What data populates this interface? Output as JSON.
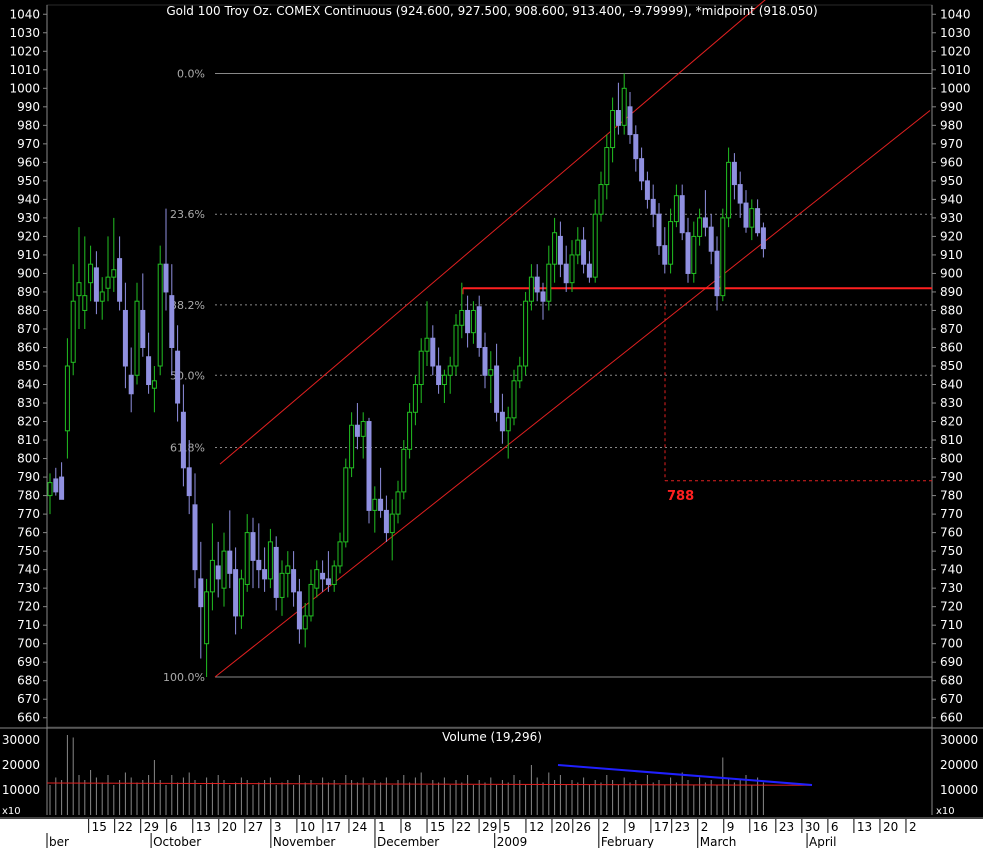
{
  "chart_data": [
    {
      "type": "candlestick",
      "title": "Gold 100 Troy Oz. COMEX Continuous (924.600, 927.500, 908.600, 913.400, -9.79999), *midpoint (918.050)",
      "ylim": [
        655,
        1045
      ],
      "y_ticks": [
        "660",
        "670",
        "680",
        "690",
        "700",
        "710",
        "720",
        "730",
        "740",
        "750",
        "760",
        "770",
        "780",
        "790",
        "800",
        "810",
        "820",
        "830",
        "840",
        "850",
        "860",
        "870",
        "880",
        "890",
        "900",
        "910",
        "920",
        "930",
        "940",
        "950",
        "960",
        "970",
        "980",
        "990",
        "1000",
        "1010",
        "1020",
        "1030",
        "1040"
      ],
      "x_ticks": [
        {
          "label": "15",
          "x": 8
        },
        {
          "label": "22",
          "x": 13
        },
        {
          "label": "29",
          "x": 18
        },
        {
          "label": "6",
          "x": 23
        },
        {
          "label": "13",
          "x": 28
        },
        {
          "label": "20",
          "x": 33
        },
        {
          "label": "27",
          "x": 38
        },
        {
          "label": "3",
          "x": 43
        },
        {
          "label": "10",
          "x": 48
        },
        {
          "label": "17",
          "x": 53
        },
        {
          "label": "24",
          "x": 58
        },
        {
          "label": "1",
          "x": 63
        },
        {
          "label": "8",
          "x": 68
        },
        {
          "label": "15",
          "x": 73
        },
        {
          "label": "22",
          "x": 78
        },
        {
          "label": "29",
          "x": 83
        },
        {
          "label": "5",
          "x": 87
        },
        {
          "label": "12",
          "x": 92
        },
        {
          "label": "20",
          "x": 97
        },
        {
          "label": "26",
          "x": 101
        },
        {
          "label": "2",
          "x": 106
        },
        {
          "label": "9",
          "x": 111
        },
        {
          "label": "17",
          "x": 116
        },
        {
          "label": "23",
          "x": 120
        },
        {
          "label": "2",
          "x": 125
        },
        {
          "label": "9",
          "x": 130
        },
        {
          "label": "16",
          "x": 135
        },
        {
          "label": "23",
          "x": 140
        },
        {
          "label": "30",
          "x": 145
        },
        {
          "label": "6",
          "x": 150
        },
        {
          "label": "13",
          "x": 155
        },
        {
          "label": "20",
          "x": 160
        },
        {
          "label": "2",
          "x": 165
        }
      ],
      "month_labels": [
        {
          "label": "ber",
          "x": 0
        },
        {
          "label": "October",
          "x": 20
        },
        {
          "label": "November",
          "x": 43
        },
        {
          "label": "December",
          "x": 63
        },
        {
          "label": "2009",
          "x": 86
        },
        {
          "label": "February",
          "x": 106
        },
        {
          "label": "March",
          "x": 125
        },
        {
          "label": "April",
          "x": 146
        }
      ],
      "fib_levels": [
        {
          "label": "0.0%",
          "value": 1008
        },
        {
          "label": "23.6%",
          "value": 932
        },
        {
          "label": "38.2%",
          "value": 883
        },
        {
          "label": "50.0%",
          "value": 845
        },
        {
          "label": "61.8%",
          "value": 806
        },
        {
          "label": "100.0%",
          "value": 682
        }
      ],
      "annotation": {
        "label": "788",
        "value": 788
      },
      "support_level": 892,
      "candles": [
        {
          "o": 780,
          "h": 792,
          "l": 770,
          "c": 787
        },
        {
          "o": 789,
          "h": 795,
          "l": 780,
          "c": 782
        },
        {
          "o": 790,
          "h": 798,
          "l": 785,
          "c": 778
        },
        {
          "o": 815,
          "h": 865,
          "l": 800,
          "c": 850
        },
        {
          "o": 852,
          "h": 905,
          "l": 845,
          "c": 885
        },
        {
          "o": 888,
          "h": 925,
          "l": 870,
          "c": 895
        },
        {
          "o": 880,
          "h": 920,
          "l": 870,
          "c": 888
        },
        {
          "o": 895,
          "h": 915,
          "l": 885,
          "c": 905
        },
        {
          "o": 903,
          "h": 912,
          "l": 878,
          "c": 885
        },
        {
          "o": 885,
          "h": 898,
          "l": 875,
          "c": 890
        },
        {
          "o": 892,
          "h": 920,
          "l": 885,
          "c": 898
        },
        {
          "o": 898,
          "h": 930,
          "l": 890,
          "c": 902
        },
        {
          "o": 908,
          "h": 920,
          "l": 880,
          "c": 885
        },
        {
          "o": 880,
          "h": 895,
          "l": 838,
          "c": 850
        },
        {
          "o": 845,
          "h": 860,
          "l": 825,
          "c": 835
        },
        {
          "o": 845,
          "h": 895,
          "l": 840,
          "c": 885
        },
        {
          "o": 880,
          "h": 900,
          "l": 855,
          "c": 860
        },
        {
          "o": 855,
          "h": 868,
          "l": 835,
          "c": 840
        },
        {
          "o": 838,
          "h": 850,
          "l": 825,
          "c": 842
        },
        {
          "o": 850,
          "h": 915,
          "l": 845,
          "c": 905
        },
        {
          "o": 905,
          "h": 935,
          "l": 880,
          "c": 890
        },
        {
          "o": 888,
          "h": 905,
          "l": 845,
          "c": 860
        },
        {
          "o": 858,
          "h": 872,
          "l": 820,
          "c": 830
        },
        {
          "o": 825,
          "h": 840,
          "l": 785,
          "c": 795
        },
        {
          "o": 795,
          "h": 810,
          "l": 770,
          "c": 780
        },
        {
          "o": 775,
          "h": 792,
          "l": 730,
          "c": 740
        },
        {
          "o": 735,
          "h": 755,
          "l": 692,
          "c": 720
        },
        {
          "o": 700,
          "h": 735,
          "l": 682,
          "c": 728
        },
        {
          "o": 728,
          "h": 765,
          "l": 718,
          "c": 745
        },
        {
          "o": 742,
          "h": 755,
          "l": 725,
          "c": 735
        },
        {
          "o": 730,
          "h": 760,
          "l": 720,
          "c": 750
        },
        {
          "o": 750,
          "h": 772,
          "l": 730,
          "c": 738
        },
        {
          "o": 740,
          "h": 752,
          "l": 705,
          "c": 715
        },
        {
          "o": 715,
          "h": 740,
          "l": 708,
          "c": 735
        },
        {
          "o": 732,
          "h": 770,
          "l": 728,
          "c": 760
        },
        {
          "o": 760,
          "h": 768,
          "l": 730,
          "c": 745
        },
        {
          "o": 745,
          "h": 765,
          "l": 730,
          "c": 740
        },
        {
          "o": 740,
          "h": 752,
          "l": 728,
          "c": 735
        },
        {
          "o": 735,
          "h": 762,
          "l": 730,
          "c": 755
        },
        {
          "o": 752,
          "h": 758,
          "l": 718,
          "c": 725
        },
        {
          "o": 725,
          "h": 745,
          "l": 715,
          "c": 738
        },
        {
          "o": 738,
          "h": 750,
          "l": 725,
          "c": 742
        },
        {
          "o": 740,
          "h": 750,
          "l": 720,
          "c": 728
        },
        {
          "o": 728,
          "h": 735,
          "l": 700,
          "c": 708
        },
        {
          "o": 708,
          "h": 722,
          "l": 698,
          "c": 715
        },
        {
          "o": 715,
          "h": 740,
          "l": 712,
          "c": 732
        },
        {
          "o": 730,
          "h": 745,
          "l": 725,
          "c": 740
        },
        {
          "o": 738,
          "h": 745,
          "l": 728,
          "c": 735
        },
        {
          "o": 735,
          "h": 750,
          "l": 728,
          "c": 732
        },
        {
          "o": 732,
          "h": 745,
          "l": 728,
          "c": 742
        },
        {
          "o": 742,
          "h": 760,
          "l": 738,
          "c": 755
        },
        {
          "o": 755,
          "h": 800,
          "l": 752,
          "c": 795
        },
        {
          "o": 795,
          "h": 825,
          "l": 790,
          "c": 818
        },
        {
          "o": 818,
          "h": 830,
          "l": 805,
          "c": 812
        },
        {
          "o": 812,
          "h": 825,
          "l": 800,
          "c": 820
        },
        {
          "o": 820,
          "h": 822,
          "l": 765,
          "c": 772
        },
        {
          "o": 772,
          "h": 785,
          "l": 760,
          "c": 778
        },
        {
          "o": 778,
          "h": 795,
          "l": 768,
          "c": 772
        },
        {
          "o": 772,
          "h": 780,
          "l": 755,
          "c": 760
        },
        {
          "o": 760,
          "h": 778,
          "l": 745,
          "c": 770
        },
        {
          "o": 770,
          "h": 788,
          "l": 765,
          "c": 782
        },
        {
          "o": 782,
          "h": 810,
          "l": 778,
          "c": 805
        },
        {
          "o": 805,
          "h": 830,
          "l": 800,
          "c": 825
        },
        {
          "o": 825,
          "h": 845,
          "l": 818,
          "c": 840
        },
        {
          "o": 840,
          "h": 865,
          "l": 830,
          "c": 858
        },
        {
          "o": 858,
          "h": 885,
          "l": 850,
          "c": 865
        },
        {
          "o": 865,
          "h": 872,
          "l": 845,
          "c": 850
        },
        {
          "o": 850,
          "h": 860,
          "l": 835,
          "c": 840
        },
        {
          "o": 840,
          "h": 848,
          "l": 830,
          "c": 845
        },
        {
          "o": 845,
          "h": 855,
          "l": 835,
          "c": 850
        },
        {
          "o": 850,
          "h": 878,
          "l": 845,
          "c": 872
        },
        {
          "o": 872,
          "h": 895,
          "l": 865,
          "c": 880
        },
        {
          "o": 880,
          "h": 888,
          "l": 860,
          "c": 868
        },
        {
          "o": 868,
          "h": 885,
          "l": 862,
          "c": 880
        },
        {
          "o": 882,
          "h": 888,
          "l": 855,
          "c": 860
        },
        {
          "o": 860,
          "h": 868,
          "l": 838,
          "c": 845
        },
        {
          "o": 845,
          "h": 858,
          "l": 830,
          "c": 848
        },
        {
          "o": 850,
          "h": 862,
          "l": 820,
          "c": 825
        },
        {
          "o": 825,
          "h": 835,
          "l": 808,
          "c": 815
        },
        {
          "o": 815,
          "h": 828,
          "l": 800,
          "c": 822
        },
        {
          "o": 822,
          "h": 848,
          "l": 818,
          "c": 842
        },
        {
          "o": 842,
          "h": 855,
          "l": 838,
          "c": 850
        },
        {
          "o": 850,
          "h": 890,
          "l": 845,
          "c": 885
        },
        {
          "o": 885,
          "h": 905,
          "l": 880,
          "c": 898
        },
        {
          "o": 898,
          "h": 905,
          "l": 885,
          "c": 890
        },
        {
          "o": 890,
          "h": 895,
          "l": 875,
          "c": 885
        },
        {
          "o": 885,
          "h": 915,
          "l": 880,
          "c": 905
        },
        {
          "o": 905,
          "h": 930,
          "l": 895,
          "c": 922
        },
        {
          "o": 920,
          "h": 928,
          "l": 898,
          "c": 905
        },
        {
          "o": 905,
          "h": 915,
          "l": 890,
          "c": 895
        },
        {
          "o": 895,
          "h": 918,
          "l": 890,
          "c": 910
        },
        {
          "o": 910,
          "h": 925,
          "l": 905,
          "c": 918
        },
        {
          "o": 918,
          "h": 925,
          "l": 900,
          "c": 905
        },
        {
          "o": 905,
          "h": 912,
          "l": 895,
          "c": 898
        },
        {
          "o": 898,
          "h": 940,
          "l": 895,
          "c": 932
        },
        {
          "o": 932,
          "h": 955,
          "l": 928,
          "c": 948
        },
        {
          "o": 948,
          "h": 975,
          "l": 940,
          "c": 968
        },
        {
          "o": 968,
          "h": 995,
          "l": 960,
          "c": 988
        },
        {
          "o": 988,
          "h": 1003,
          "l": 975,
          "c": 980
        },
        {
          "o": 980,
          "h": 1008,
          "l": 975,
          "c": 1000
        },
        {
          "o": 990,
          "h": 998,
          "l": 970,
          "c": 975
        },
        {
          "o": 975,
          "h": 980,
          "l": 955,
          "c": 962
        },
        {
          "o": 962,
          "h": 968,
          "l": 945,
          "c": 950
        },
        {
          "o": 950,
          "h": 955,
          "l": 935,
          "c": 940
        },
        {
          "o": 940,
          "h": 948,
          "l": 925,
          "c": 932
        },
        {
          "o": 932,
          "h": 938,
          "l": 910,
          "c": 915
        },
        {
          "o": 915,
          "h": 925,
          "l": 900,
          "c": 905
        },
        {
          "o": 905,
          "h": 935,
          "l": 900,
          "c": 928
        },
        {
          "o": 928,
          "h": 948,
          "l": 925,
          "c": 942
        },
        {
          "o": 942,
          "h": 948,
          "l": 918,
          "c": 922
        },
        {
          "o": 922,
          "h": 930,
          "l": 895,
          "c": 900
        },
        {
          "o": 900,
          "h": 928,
          "l": 895,
          "c": 920
        },
        {
          "o": 920,
          "h": 935,
          "l": 915,
          "c": 930
        },
        {
          "o": 930,
          "h": 945,
          "l": 920,
          "c": 925
        },
        {
          "o": 925,
          "h": 932,
          "l": 905,
          "c": 912
        },
        {
          "o": 912,
          "h": 920,
          "l": 880,
          "c": 888
        },
        {
          "o": 888,
          "h": 935,
          "l": 885,
          "c": 930
        },
        {
          "o": 930,
          "h": 968,
          "l": 925,
          "c": 960
        },
        {
          "o": 960,
          "h": 965,
          "l": 940,
          "c": 948
        },
        {
          "o": 948,
          "h": 955,
          "l": 930,
          "c": 938
        },
        {
          "o": 938,
          "h": 945,
          "l": 922,
          "c": 925
        },
        {
          "o": 925,
          "h": 940,
          "l": 918,
          "c": 935
        },
        {
          "o": 935,
          "h": 940,
          "l": 920,
          "c": 922
        },
        {
          "o": 924.6,
          "h": 927.5,
          "l": 908.6,
          "c": 913.4
        }
      ]
    },
    {
      "type": "bar",
      "title": "Volume (19,296)",
      "ylim": [
        0,
        32000
      ],
      "y_ticks": [
        "10000",
        "20000",
        "30000"
      ],
      "multiplier": "x10",
      "volume": [
        12000,
        15000,
        14000,
        32000,
        31000,
        16000,
        14000,
        18000,
        15000,
        13000,
        16000,
        12000,
        14000,
        17000,
        15000,
        13000,
        14000,
        16000,
        22000,
        14000,
        12000,
        16000,
        13000,
        15000,
        17000,
        14000,
        12000,
        15000,
        13000,
        16000,
        14000,
        12000,
        13000,
        15000,
        14000,
        12000,
        13000,
        14000,
        15000,
        12000,
        13000,
        14000,
        12000,
        16000,
        13000,
        14000,
        12000,
        15000,
        13000,
        14000,
        12000,
        16000,
        14000,
        13000,
        15000,
        12000,
        14000,
        13000,
        15000,
        12000,
        14000,
        16000,
        13000,
        15000,
        17000,
        12000,
        14000,
        13000,
        15000,
        12000,
        14000,
        13000,
        16000,
        12000,
        14000,
        13000,
        15000,
        12000,
        14000,
        13000,
        16000,
        14000,
        12000,
        20000,
        15000,
        13000,
        17000,
        14000,
        16000,
        12000,
        14000,
        13000,
        15000,
        12000,
        14000,
        13000,
        16000,
        14000,
        12000,
        15000,
        13000,
        14000,
        12000,
        16000,
        13000,
        14000,
        12000,
        15000,
        13000,
        17000,
        14000,
        12000,
        15000,
        13000,
        14000,
        12000,
        23000,
        15000,
        13000,
        14000,
        16000,
        12000,
        15000,
        13000
      ],
      "ma_level": 12800
    }
  ]
}
